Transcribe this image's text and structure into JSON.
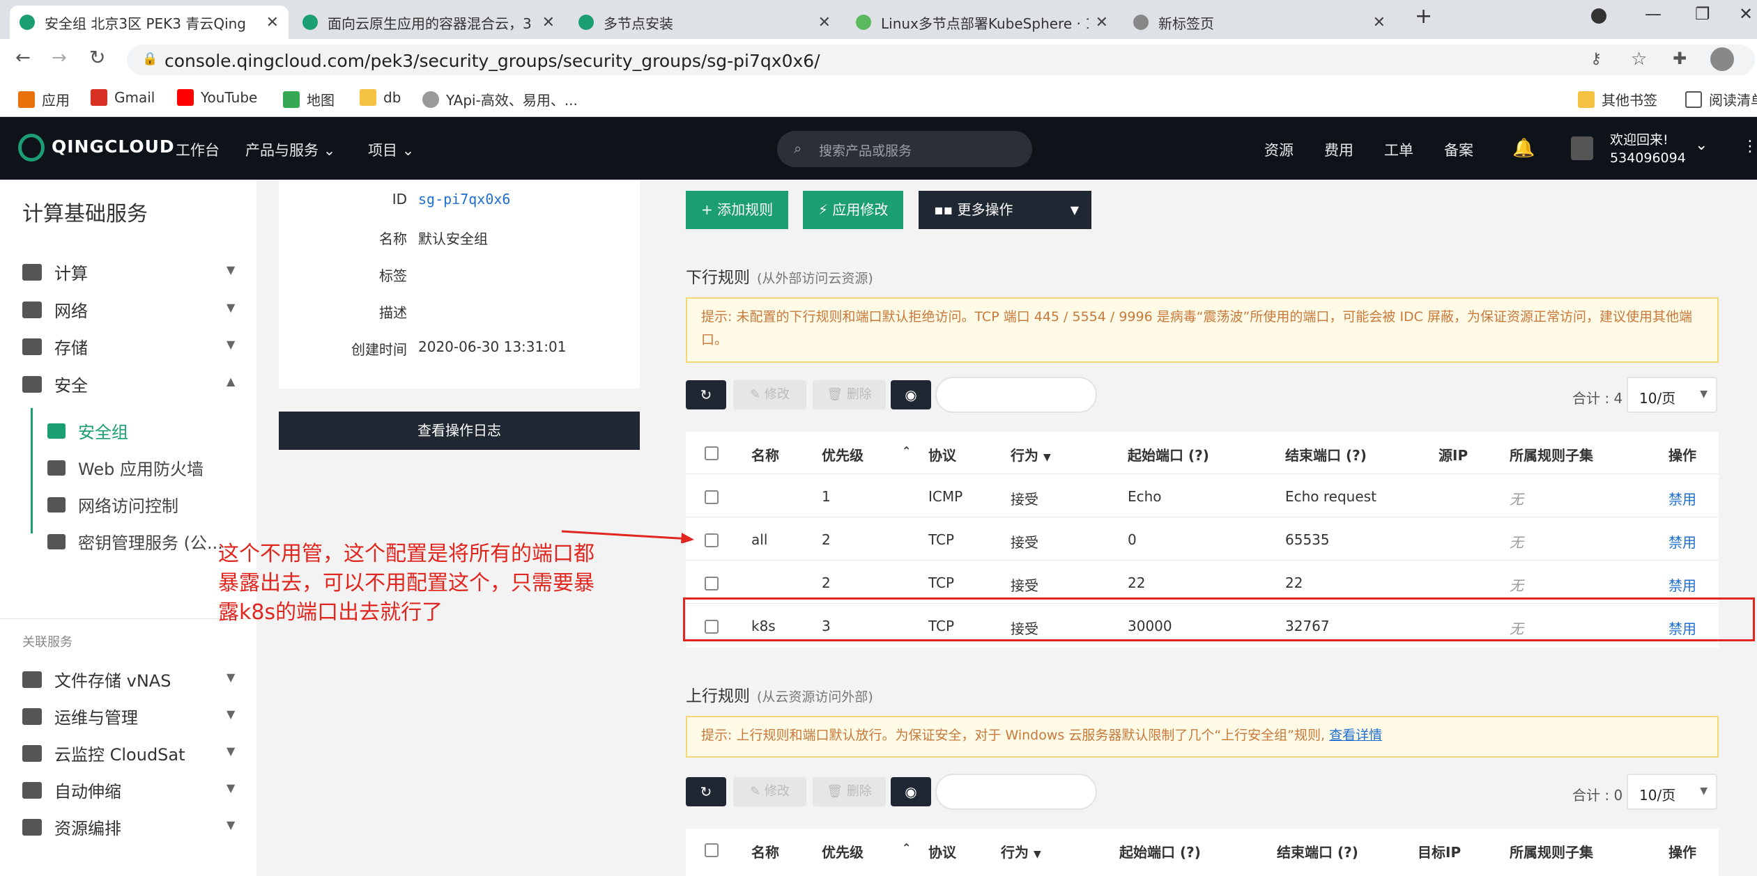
{
  "browser": {
    "tabs": [
      {
        "title": "安全组 北京3区 PEK3 青云Qing",
        "active": true
      },
      {
        "title": "面向云原生应用的容器混合云，3"
      },
      {
        "title": "多节点安装"
      },
      {
        "title": "Linux多节点部署KubeSphere · 1"
      },
      {
        "title": "新标签页"
      }
    ],
    "url": "console.qingcloud.com/pek3/security_groups/security_groups/sg-pi7qx0x6/",
    "bookmarks": [
      "应用",
      "Gmail",
      "YouTube",
      "地图",
      "db",
      "YApi-高效、易用、..."
    ],
    "bookmarks_right": [
      "其他书签",
      "阅读清单"
    ]
  },
  "header": {
    "logo": "QINGCLOUD",
    "nav": [
      "工作台",
      "产品与服务",
      "项目"
    ],
    "search_placeholder": "搜索产品或服务",
    "right_nav": [
      "资源",
      "费用",
      "工单",
      "备案"
    ],
    "welcome": "欢迎回来!",
    "user_id": "534096094"
  },
  "sidebar": {
    "title": "计算基础服务",
    "items": [
      "计算",
      "网络",
      "存储",
      "安全"
    ],
    "security_sub": [
      "安全组",
      "Web 应用防火墙",
      "网络访问控制",
      "密钥管理服务 (公..."
    ],
    "related_label": "关联服务",
    "related_items": [
      "文件存储 vNAS",
      "运维与管理",
      "云监控 CloudSat",
      "自动伸缩",
      "资源编排"
    ]
  },
  "info": {
    "id_label": "ID",
    "id_value": "sg-pi7qx0x6",
    "name_label": "名称",
    "name_value": "默认安全组",
    "tag_label": "标签",
    "desc_label": "描述",
    "created_label": "创建时间",
    "created_value": "2020-06-30 13:31:01",
    "log_button": "查看操作日志"
  },
  "actions": {
    "add_rule": "+ 添加规则",
    "apply": "⚡ 应用修改",
    "more": "更多操作"
  },
  "inbound": {
    "title": "下行规则",
    "subtitle": "(从外部访问云资源)",
    "notice": "提示: 未配置的下行规则和端口默认拒绝访问。TCP 端口 445 / 5554 / 9996 是病毒“震荡波”所使用的端口，可能会被 IDC 屏蔽，为保证资源正常访问，建议使用其他端口。",
    "edit": "修改",
    "delete": "删除",
    "total": "合计 : 4",
    "per_page": "10/页",
    "columns": [
      "名称",
      "优先级",
      "协议",
      "行为",
      "起始端口 (?)",
      "结束端口 (?)",
      "源IP",
      "所属规则子集",
      "操作"
    ],
    "rows": [
      {
        "name": "",
        "priority": "1",
        "protocol": "ICMP",
        "action": "接受",
        "start": "Echo",
        "end": "Echo request",
        "ip": "",
        "subset": "无",
        "op": "禁用"
      },
      {
        "name": "all",
        "priority": "2",
        "protocol": "TCP",
        "action": "接受",
        "start": "0",
        "end": "65535",
        "ip": "",
        "subset": "无",
        "op": "禁用"
      },
      {
        "name": "",
        "priority": "2",
        "protocol": "TCP",
        "action": "接受",
        "start": "22",
        "end": "22",
        "ip": "",
        "subset": "无",
        "op": "禁用"
      },
      {
        "name": "k8s",
        "priority": "3",
        "protocol": "TCP",
        "action": "接受",
        "start": "30000",
        "end": "32767",
        "ip": "",
        "subset": "无",
        "op": "禁用"
      }
    ]
  },
  "outbound": {
    "title": "上行规则",
    "subtitle": "(从云资源访问外部)",
    "notice": "提示: 上行规则和端口默认放行。为保证安全，对于 Windows 云服务器默认限制了几个“上行安全组”规则,",
    "notice_link": "查看详情",
    "edit": "修改",
    "delete": "删除",
    "total": "合计 : 0",
    "per_page": "10/页",
    "columns": [
      "名称",
      "优先级",
      "协议",
      "行为",
      "起始端口 (?)",
      "结束端口 (?)",
      "目标IP",
      "所属规则子集",
      "操作"
    ]
  },
  "annotation": "这个不用管，这个配置是将所有的端口都暴露出去，可以不用配置这个，只需要暴露k8s的端口出去就行了",
  "colors": {
    "green": "#1b9e72",
    "dark": "#1f2733",
    "red": "#e0261f",
    "link": "#1f6fd1"
  }
}
